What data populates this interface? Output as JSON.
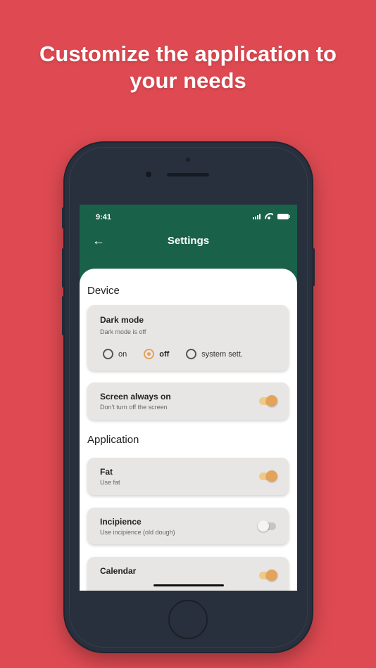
{
  "headline": {
    "line1": "Customize the application to",
    "line2": "your needs"
  },
  "status_bar": {
    "time": "9:41"
  },
  "app_bar": {
    "title": "Settings"
  },
  "sections": {
    "device": "Device",
    "application": "Application"
  },
  "dark_mode": {
    "title": "Dark mode",
    "subtitle": "Dark mode is off",
    "options": [
      "on",
      "off",
      "system sett."
    ],
    "selected": "off"
  },
  "screen_always_on": {
    "title": "Screen always on",
    "subtitle": "Don't turn off the screen",
    "enabled": true
  },
  "fat": {
    "title": "Fat",
    "subtitle": "Use fat",
    "enabled": true
  },
  "incipience": {
    "title": "Incipience",
    "subtitle": "Use incipience (old dough)",
    "enabled": false
  },
  "calendar": {
    "title": "Calendar",
    "enabled": true
  },
  "colors": {
    "background": "#df4a52",
    "app_bar": "#1a6149",
    "accent": "#e3a35a",
    "card": "#e8e6e4"
  }
}
